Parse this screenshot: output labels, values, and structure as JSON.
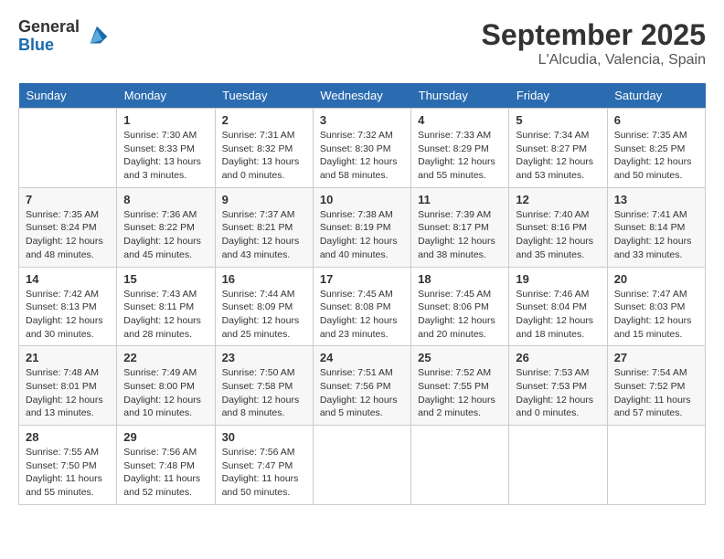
{
  "header": {
    "logo_general": "General",
    "logo_blue": "Blue",
    "month": "September 2025",
    "location": "L'Alcudia, Valencia, Spain"
  },
  "days_of_week": [
    "Sunday",
    "Monday",
    "Tuesday",
    "Wednesday",
    "Thursday",
    "Friday",
    "Saturday"
  ],
  "weeks": [
    [
      {
        "day": "",
        "info": ""
      },
      {
        "day": "1",
        "info": "Sunrise: 7:30 AM\nSunset: 8:33 PM\nDaylight: 13 hours\nand 3 minutes."
      },
      {
        "day": "2",
        "info": "Sunrise: 7:31 AM\nSunset: 8:32 PM\nDaylight: 13 hours\nand 0 minutes."
      },
      {
        "day": "3",
        "info": "Sunrise: 7:32 AM\nSunset: 8:30 PM\nDaylight: 12 hours\nand 58 minutes."
      },
      {
        "day": "4",
        "info": "Sunrise: 7:33 AM\nSunset: 8:29 PM\nDaylight: 12 hours\nand 55 minutes."
      },
      {
        "day": "5",
        "info": "Sunrise: 7:34 AM\nSunset: 8:27 PM\nDaylight: 12 hours\nand 53 minutes."
      },
      {
        "day": "6",
        "info": "Sunrise: 7:35 AM\nSunset: 8:25 PM\nDaylight: 12 hours\nand 50 minutes."
      }
    ],
    [
      {
        "day": "7",
        "info": "Sunrise: 7:35 AM\nSunset: 8:24 PM\nDaylight: 12 hours\nand 48 minutes."
      },
      {
        "day": "8",
        "info": "Sunrise: 7:36 AM\nSunset: 8:22 PM\nDaylight: 12 hours\nand 45 minutes."
      },
      {
        "day": "9",
        "info": "Sunrise: 7:37 AM\nSunset: 8:21 PM\nDaylight: 12 hours\nand 43 minutes."
      },
      {
        "day": "10",
        "info": "Sunrise: 7:38 AM\nSunset: 8:19 PM\nDaylight: 12 hours\nand 40 minutes."
      },
      {
        "day": "11",
        "info": "Sunrise: 7:39 AM\nSunset: 8:17 PM\nDaylight: 12 hours\nand 38 minutes."
      },
      {
        "day": "12",
        "info": "Sunrise: 7:40 AM\nSunset: 8:16 PM\nDaylight: 12 hours\nand 35 minutes."
      },
      {
        "day": "13",
        "info": "Sunrise: 7:41 AM\nSunset: 8:14 PM\nDaylight: 12 hours\nand 33 minutes."
      }
    ],
    [
      {
        "day": "14",
        "info": "Sunrise: 7:42 AM\nSunset: 8:13 PM\nDaylight: 12 hours\nand 30 minutes."
      },
      {
        "day": "15",
        "info": "Sunrise: 7:43 AM\nSunset: 8:11 PM\nDaylight: 12 hours\nand 28 minutes."
      },
      {
        "day": "16",
        "info": "Sunrise: 7:44 AM\nSunset: 8:09 PM\nDaylight: 12 hours\nand 25 minutes."
      },
      {
        "day": "17",
        "info": "Sunrise: 7:45 AM\nSunset: 8:08 PM\nDaylight: 12 hours\nand 23 minutes."
      },
      {
        "day": "18",
        "info": "Sunrise: 7:45 AM\nSunset: 8:06 PM\nDaylight: 12 hours\nand 20 minutes."
      },
      {
        "day": "19",
        "info": "Sunrise: 7:46 AM\nSunset: 8:04 PM\nDaylight: 12 hours\nand 18 minutes."
      },
      {
        "day": "20",
        "info": "Sunrise: 7:47 AM\nSunset: 8:03 PM\nDaylight: 12 hours\nand 15 minutes."
      }
    ],
    [
      {
        "day": "21",
        "info": "Sunrise: 7:48 AM\nSunset: 8:01 PM\nDaylight: 12 hours\nand 13 minutes."
      },
      {
        "day": "22",
        "info": "Sunrise: 7:49 AM\nSunset: 8:00 PM\nDaylight: 12 hours\nand 10 minutes."
      },
      {
        "day": "23",
        "info": "Sunrise: 7:50 AM\nSunset: 7:58 PM\nDaylight: 12 hours\nand 8 minutes."
      },
      {
        "day": "24",
        "info": "Sunrise: 7:51 AM\nSunset: 7:56 PM\nDaylight: 12 hours\nand 5 minutes."
      },
      {
        "day": "25",
        "info": "Sunrise: 7:52 AM\nSunset: 7:55 PM\nDaylight: 12 hours\nand 2 minutes."
      },
      {
        "day": "26",
        "info": "Sunrise: 7:53 AM\nSunset: 7:53 PM\nDaylight: 12 hours\nand 0 minutes."
      },
      {
        "day": "27",
        "info": "Sunrise: 7:54 AM\nSunset: 7:52 PM\nDaylight: 11 hours\nand 57 minutes."
      }
    ],
    [
      {
        "day": "28",
        "info": "Sunrise: 7:55 AM\nSunset: 7:50 PM\nDaylight: 11 hours\nand 55 minutes."
      },
      {
        "day": "29",
        "info": "Sunrise: 7:56 AM\nSunset: 7:48 PM\nDaylight: 11 hours\nand 52 minutes."
      },
      {
        "day": "30",
        "info": "Sunrise: 7:56 AM\nSunset: 7:47 PM\nDaylight: 11 hours\nand 50 minutes."
      },
      {
        "day": "",
        "info": ""
      },
      {
        "day": "",
        "info": ""
      },
      {
        "day": "",
        "info": ""
      },
      {
        "day": "",
        "info": ""
      }
    ]
  ]
}
